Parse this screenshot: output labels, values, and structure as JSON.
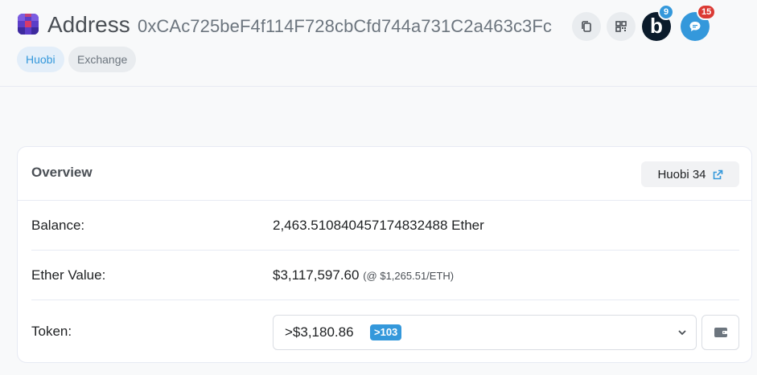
{
  "header": {
    "title": "Address",
    "address": "0xCAc725beF4f114F728cbCfd744a731C2a463c3Fc",
    "copy_icon": "copy-icon",
    "qr_icon": "qr-code-icon",
    "blockscan": {
      "letter": "b",
      "badge": "9",
      "color": "#0b1b2b"
    },
    "chat": {
      "badge": "15",
      "color": "#3498db",
      "badge_color": "#db3a34"
    }
  },
  "tags": [
    {
      "label": "Huobi",
      "color": "#3498db",
      "bg": "#e3eef9"
    },
    {
      "label": "Exchange",
      "color": "#6c757e",
      "bg": "#e9ecef"
    }
  ],
  "overview": {
    "title": "Overview",
    "name_tag": "Huobi 34",
    "name_tag_icon": "external-link-icon",
    "balance": {
      "label": "Balance:",
      "value": "2,463.510840457174832488 Ether"
    },
    "ether_value": {
      "label": "Ether Value:",
      "value": "$3,117,597.60",
      "sub": "(@ $1,265.51/ETH)"
    },
    "token": {
      "label": "Token:",
      "amount": ">$3,180.86",
      "count": ">103",
      "wallet_icon": "wallet-icon"
    }
  }
}
